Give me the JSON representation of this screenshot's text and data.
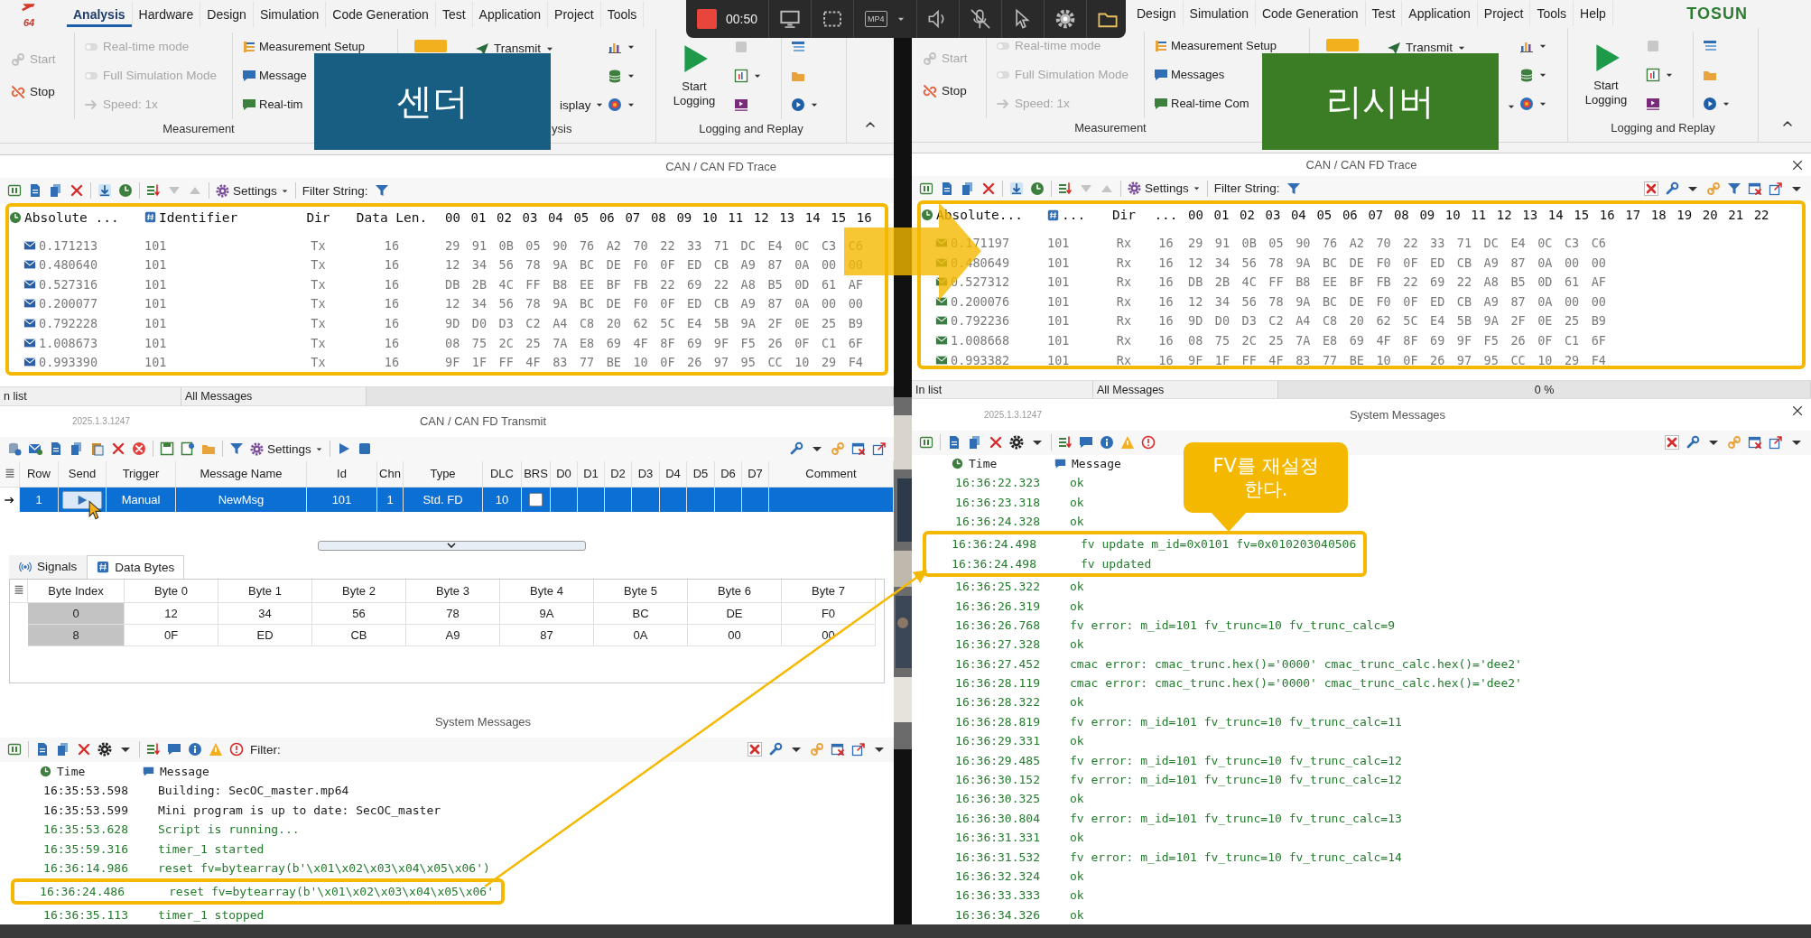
{
  "recorder": {
    "time": "00:50",
    "format": "MP4"
  },
  "callout": "FV를 재설정 한다.",
  "panes": [
    {
      "kind": "sender",
      "badge": "센더",
      "logo": "64",
      "menu": [
        {
          "label": "Analysis",
          "selected": true
        },
        {
          "label": "Hardware",
          "selected": false
        },
        {
          "label": "Design",
          "selected": false
        },
        {
          "label": "Simulation",
          "selected": false
        },
        {
          "label": "Code Generation",
          "selected": false
        },
        {
          "label": "Test",
          "selected": false
        },
        {
          "label": "Application",
          "selected": false
        },
        {
          "label": "Project",
          "selected": false
        },
        {
          "label": "Tools",
          "selected": false
        }
      ],
      "ribbon": {
        "run": [
          {
            "kind": "start",
            "label": "Start",
            "disabled": true
          },
          {
            "kind": "stop",
            "label": "Stop",
            "disabled": false
          }
        ],
        "modes": [
          {
            "kind": "toggle",
            "label": "Real-time mode",
            "disabled": true
          },
          {
            "kind": "toggle",
            "label": "Full Simulation Mode",
            "disabled": true
          },
          {
            "kind": "speed",
            "label": "Speed: 1x",
            "disabled": true
          }
        ],
        "views": [
          {
            "kind": "setup",
            "label": "Measurement Setup"
          },
          {
            "kind": "messages",
            "label": "Message"
          },
          {
            "kind": "realtime",
            "label": "Real-tim"
          }
        ],
        "measurement_label": "Measurement",
        "transmit": "Transmit",
        "display": "isplay",
        "analysis_label": "ysis",
        "logging_button": "Start Logging",
        "logging_label": "Logging and Replay"
      },
      "trace": {
        "title": "CAN / CAN FD Trace",
        "settings": "Settings",
        "filter_label": "Filter String:",
        "columns": [
          "Absolute ...",
          "Identifier",
          "Dir",
          "Data Len."
        ],
        "byte_header": "00 01 02 03 04 05 06 07 08 09 10 11 12 13 14 15 16",
        "rows": [
          {
            "time": "0.171213",
            "id": "101",
            "dir": "Tx",
            "len": "16",
            "data": "29 91 0B 05 90 76 A2 70 22 33 71 DC E4 0C C3 C6"
          },
          {
            "time": "0.480640",
            "id": "101",
            "dir": "Tx",
            "len": "16",
            "data": "12 34 56 78 9A BC DE F0 0F ED CB A9 87 0A 00 00"
          },
          {
            "time": "0.527316",
            "id": "101",
            "dir": "Tx",
            "len": "16",
            "data": "DB 2B 4C FF B8 EE BF FB 22 69 22 A8 B5 0D 61 AF"
          },
          {
            "time": "0.200077",
            "id": "101",
            "dir": "Tx",
            "len": "16",
            "data": "12 34 56 78 9A BC DE F0 0F ED CB A9 87 0A 00 00"
          },
          {
            "time": "0.792228",
            "id": "101",
            "dir": "Tx",
            "len": "16",
            "data": "9D D0 D3 C2 A4 C8 20 62 5C E4 5B 9A 2F 0E 25 B9"
          },
          {
            "time": "1.008673",
            "id": "101",
            "dir": "Tx",
            "len": "16",
            "data": "08 75 2C 25 7A E8 69 4F 8F 69 9F F5 26 0F C1 6F"
          },
          {
            "time": "0.993390",
            "id": "101",
            "dir": "Tx",
            "len": "16",
            "data": "9F 1F FF 4F 83 77 BE 10 0F 26 97 95 CC 10 29 F4"
          }
        ],
        "status": [
          "n list",
          "All Messages"
        ],
        "level": 0
      },
      "transmit": {
        "version": "2025.1.3.1247",
        "title": "CAN / CAN FD Transmit",
        "settings": "Settings",
        "columns": [
          "Row",
          "Send",
          "Trigger",
          "Message Name",
          "Id",
          "Chn",
          "Type",
          "DLC",
          "BRS",
          "D0",
          "D1",
          "D2",
          "D3",
          "D4",
          "D5",
          "D6",
          "D7",
          "Comment"
        ],
        "rows": [
          {
            "selected": true,
            "row": "1",
            "trigger": "Manual",
            "name": "NewMsg",
            "id": "101",
            "chn": "1",
            "type": "Std. FD",
            "dlc": "10",
            "brs": false
          }
        ]
      },
      "detail": {
        "tabs": [
          {
            "kind": "signals",
            "label": "Signals",
            "selected": false
          },
          {
            "kind": "bytes",
            "label": "Data Bytes",
            "selected": true
          }
        ],
        "columns": [
          "Byte Index",
          "Byte 0",
          "Byte 1",
          "Byte 2",
          "Byte 3",
          "Byte 4",
          "Byte 5",
          "Byte 6",
          "Byte 7"
        ],
        "rows": [
          {
            "index": "0",
            "bytes": [
              "12",
              "34",
              "56",
              "78",
              "9A",
              "BC",
              "DE",
              "F0"
            ]
          },
          {
            "index": "8",
            "bytes": [
              "0F",
              "ED",
              "CB",
              "A9",
              "87",
              "0A",
              "00",
              "00"
            ]
          }
        ]
      },
      "messages": {
        "title": "System Messages",
        "filter_label": "Filter:",
        "columns": [
          "Time",
          "Message"
        ],
        "rows": [
          {
            "kind": "line",
            "time": "16:35:53.598",
            "text": "Building: SecOC_master.mp64",
            "color": "#1a1a1a"
          },
          {
            "kind": "line",
            "time": "16:35:53.599",
            "text": "Mini program is up to date: SecOC_master",
            "color": "#1a1a1a"
          },
          {
            "kind": "line",
            "time": "16:35:53.628",
            "text": "Script is running...",
            "color": "#237a2c"
          },
          {
            "kind": "line",
            "time": "16:35:59.316",
            "text": "timer_1 started",
            "color": "#237a2c"
          },
          {
            "kind": "line",
            "time": "16:36:14.986",
            "text": "reset fv=bytearray(b'\\x01\\x02\\x03\\x04\\x05\\x06')",
            "color": "#237a2c"
          },
          {
            "kind": "highlight",
            "rows": [
              {
                "time": "16:36:24.486",
                "text": "reset fv=bytearray(b'\\x01\\x02\\x03\\x04\\x05\\x06'",
                "color": "#237a2c"
              }
            ]
          },
          {
            "kind": "line",
            "time": "16:36:35.113",
            "text": "timer_1 stopped",
            "color": "#237a2c"
          }
        ]
      }
    },
    {
      "kind": "receiver",
      "badge": "리시버",
      "brand": "TOSUN",
      "menu": [
        {
          "label": "Design",
          "selected": false
        },
        {
          "label": "Simulation",
          "selected": false
        },
        {
          "label": "Code Generation",
          "selected": false
        },
        {
          "label": "Test",
          "selected": false
        },
        {
          "label": "Application",
          "selected": false
        },
        {
          "label": "Project",
          "selected": false
        },
        {
          "label": "Tools",
          "selected": false
        },
        {
          "label": "Help",
          "selected": false
        }
      ],
      "ribbon": {
        "run": [
          {
            "kind": "start",
            "label": "Start",
            "disabled": true
          },
          {
            "kind": "stop",
            "label": "Stop",
            "disabled": false
          }
        ],
        "modes": [
          {
            "kind": "toggle",
            "label": "Real-time mode",
            "disabled": true
          },
          {
            "kind": "toggle",
            "label": "Full Simulation Mode",
            "disabled": true
          },
          {
            "kind": "speed",
            "label": "Speed: 1x",
            "disabled": true
          }
        ],
        "views": [
          {
            "kind": "setup",
            "label": "Measurement Setup"
          },
          {
            "kind": "messages",
            "label": "Messages"
          },
          {
            "kind": "realtime",
            "label": "Real-time Com"
          }
        ],
        "measurement_label": "Measurement",
        "transmit": "Transmit",
        "logging_button": "Start Logging",
        "logging_label": "Logging and Replay"
      },
      "trace": {
        "title": "CAN / CAN FD Trace",
        "settings": "Settings",
        "filter_label": "Filter String:",
        "columns": [
          "Absolute...",
          "...",
          "Dir",
          "..."
        ],
        "byte_header": "00 01 02 03 04 05 06 07 08 09 10 11 12 13 14 15 16 17 18 19 20 21 22",
        "rows": [
          {
            "time": "0.171197",
            "id": "101",
            "dir": "Rx",
            "len": "16",
            "data": "29 91 0B 05 90 76 A2 70 22 33 71 DC E4 0C C3 C6"
          },
          {
            "time": "0.480649",
            "id": "101",
            "dir": "Rx",
            "len": "16",
            "data": "12 34 56 78 9A BC DE F0 0F ED CB A9 87 0A 00 00"
          },
          {
            "time": "0.527312",
            "id": "101",
            "dir": "Rx",
            "len": "16",
            "data": "DB 2B 4C FF B8 EE BF FB 22 69 22 A8 B5 0D 61 AF"
          },
          {
            "time": "0.200076",
            "id": "101",
            "dir": "Rx",
            "len": "16",
            "data": "12 34 56 78 9A BC DE F0 0F ED CB A9 87 0A 00 00"
          },
          {
            "time": "0.792236",
            "id": "101",
            "dir": "Rx",
            "len": "16",
            "data": "9D D0 D3 C2 A4 C8 20 62 5C E4 5B 9A 2F 0E 25 B9"
          },
          {
            "time": "1.008668",
            "id": "101",
            "dir": "Rx",
            "len": "16",
            "data": "08 75 2C 25 7A E8 69 4F 8F 69 9F F5 26 0F C1 6F"
          },
          {
            "time": "0.993382",
            "id": "101",
            "dir": "Rx",
            "len": "16",
            "data": "9F 1F FF 4F 83 77 BE 10 0F 26 97 95 CC 10 29 F4"
          }
        ],
        "status": [
          "In list",
          "All Messages"
        ],
        "progress": "0 %",
        "level": 0
      },
      "messages": {
        "version": "2025.1.3.1247",
        "title": "System Messages",
        "columns": [
          "Time",
          "Message"
        ],
        "rows": [
          {
            "kind": "line",
            "time": "16:36:22.323",
            "text": "ok",
            "color": "#237a2c"
          },
          {
            "kind": "line",
            "time": "16:36:23.318",
            "text": "ok",
            "color": "#237a2c"
          },
          {
            "kind": "line",
            "time": "16:36:24.328",
            "text": "ok",
            "color": "#237a2c"
          },
          {
            "kind": "highlight",
            "rows": [
              {
                "time": "16:36:24.498",
                "text": "fv update m_id=0x0101 fv=0x010203040506",
                "color": "#237a2c"
              },
              {
                "time": "16:36:24.498",
                "text": "fv updated",
                "color": "#237a2c"
              }
            ]
          },
          {
            "kind": "line",
            "time": "16:36:25.322",
            "text": "ok",
            "color": "#237a2c"
          },
          {
            "kind": "line",
            "time": "16:36:26.319",
            "text": "ok",
            "color": "#237a2c"
          },
          {
            "kind": "line",
            "time": "16:36:26.768",
            "text": "fv error: m_id=101 fv_trunc=10 fv_trunc_calc=9",
            "color": "#237a2c"
          },
          {
            "kind": "line",
            "time": "16:36:27.328",
            "text": "ok",
            "color": "#237a2c"
          },
          {
            "kind": "line",
            "time": "16:36:27.452",
            "text": "cmac error: cmac_trunc.hex()='0000' cmac_trunc_calc.hex()='dee2'",
            "color": "#237a2c"
          },
          {
            "kind": "line",
            "time": "16:36:28.119",
            "text": "cmac error: cmac_trunc.hex()='0000' cmac_trunc_calc.hex()='dee2'",
            "color": "#237a2c"
          },
          {
            "kind": "line",
            "time": "16:36:28.322",
            "text": "ok",
            "color": "#237a2c"
          },
          {
            "kind": "line",
            "time": "16:36:28.819",
            "text": "fv error: m_id=101 fv_trunc=10 fv_trunc_calc=11",
            "color": "#237a2c"
          },
          {
            "kind": "line",
            "time": "16:36:29.331",
            "text": "ok",
            "color": "#237a2c"
          },
          {
            "kind": "line",
            "time": "16:36:29.485",
            "text": "fv error: m_id=101 fv_trunc=10 fv_trunc_calc=12",
            "color": "#237a2c"
          },
          {
            "kind": "line",
            "time": "16:36:30.152",
            "text": "fv error: m_id=101 fv_trunc=10 fv_trunc_calc=12",
            "color": "#237a2c"
          },
          {
            "kind": "line",
            "time": "16:36:30.325",
            "text": "ok",
            "color": "#237a2c"
          },
          {
            "kind": "line",
            "time": "16:36:30.804",
            "text": "fv error: m_id=101 fv_trunc=10 fv_trunc_calc=13",
            "color": "#237a2c"
          },
          {
            "kind": "line",
            "time": "16:36:31.331",
            "text": "ok",
            "color": "#237a2c"
          },
          {
            "kind": "line",
            "time": "16:36:31.532",
            "text": "fv error: m_id=101 fv_trunc=10 fv_trunc_calc=14",
            "color": "#237a2c"
          },
          {
            "kind": "line",
            "time": "16:36:32.324",
            "text": "ok",
            "color": "#237a2c"
          },
          {
            "kind": "line",
            "time": "16:36:33.333",
            "text": "ok",
            "color": "#237a2c"
          },
          {
            "kind": "line",
            "time": "16:36:34.326",
            "text": "ok",
            "color": "#237a2c"
          }
        ]
      }
    }
  ]
}
